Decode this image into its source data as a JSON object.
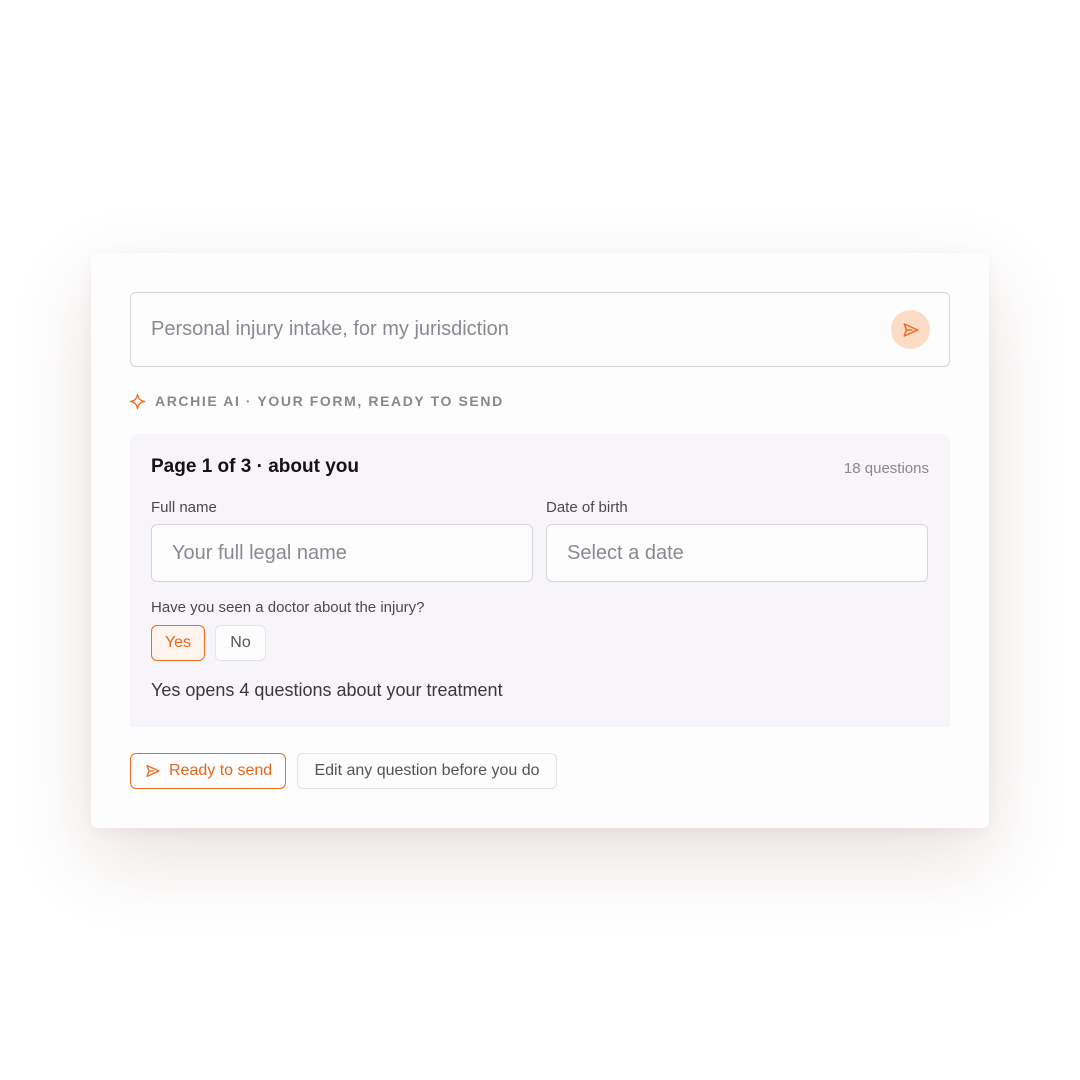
{
  "prompt": {
    "text": "Personal injury intake, for my jurisdiction",
    "send_icon": "send-icon"
  },
  "ai_label": {
    "icon": "sparkle-icon",
    "text": "ARCHIE AI · YOUR FORM, READY TO SEND"
  },
  "form_preview": {
    "title": "Page 1 of 3 · about you",
    "question_count": "18 questions",
    "fields": [
      {
        "label": "Full name",
        "placeholder": "Your full legal name"
      },
      {
        "label": "Date of birth",
        "placeholder": "Select a date"
      }
    ],
    "doctor_question": {
      "label": "Have you seen a doctor about the injury?",
      "options": [
        "Yes",
        "No"
      ],
      "selected": "Yes"
    },
    "hint": "Yes opens 4 questions about your treatment"
  },
  "actions": {
    "ready_label": "Ready to send",
    "edit_label": "Edit any question before you do"
  },
  "colors": {
    "accent": "#ee6a1e",
    "accent_soft": "#fcdcc4",
    "panel_bg": "#f7f5f9"
  }
}
